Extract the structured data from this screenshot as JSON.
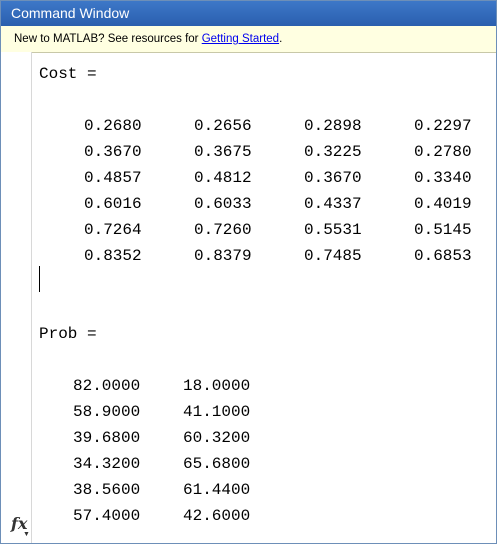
{
  "window": {
    "title": "Command Window"
  },
  "infobar": {
    "text": "New to MATLAB? See resources for ",
    "link": "Getting Started",
    "suffix": "."
  },
  "icons": {
    "function": "fx-function-browser-icon"
  },
  "cost": {
    "header": "Cost =",
    "rows": [
      [
        "0.2680",
        "0.2656",
        "0.2898",
        "0.2297"
      ],
      [
        "0.3670",
        "0.3675",
        "0.3225",
        "0.2780"
      ],
      [
        "0.4857",
        "0.4812",
        "0.3670",
        "0.3340"
      ],
      [
        "0.6016",
        "0.6033",
        "0.4337",
        "0.4019"
      ],
      [
        "0.7264",
        "0.7260",
        "0.5531",
        "0.5145"
      ],
      [
        "0.8352",
        "0.8379",
        "0.7485",
        "0.6853"
      ]
    ]
  },
  "prob": {
    "header": "Prob =",
    "rows": [
      [
        "82.0000",
        "18.0000"
      ],
      [
        "58.9000",
        "41.1000"
      ],
      [
        "39.6800",
        "60.3200"
      ],
      [
        "34.3200",
        "65.6800"
      ],
      [
        "38.5600",
        "61.4400"
      ],
      [
        "57.4000",
        "42.6000"
      ]
    ]
  },
  "fx_label": "fx"
}
